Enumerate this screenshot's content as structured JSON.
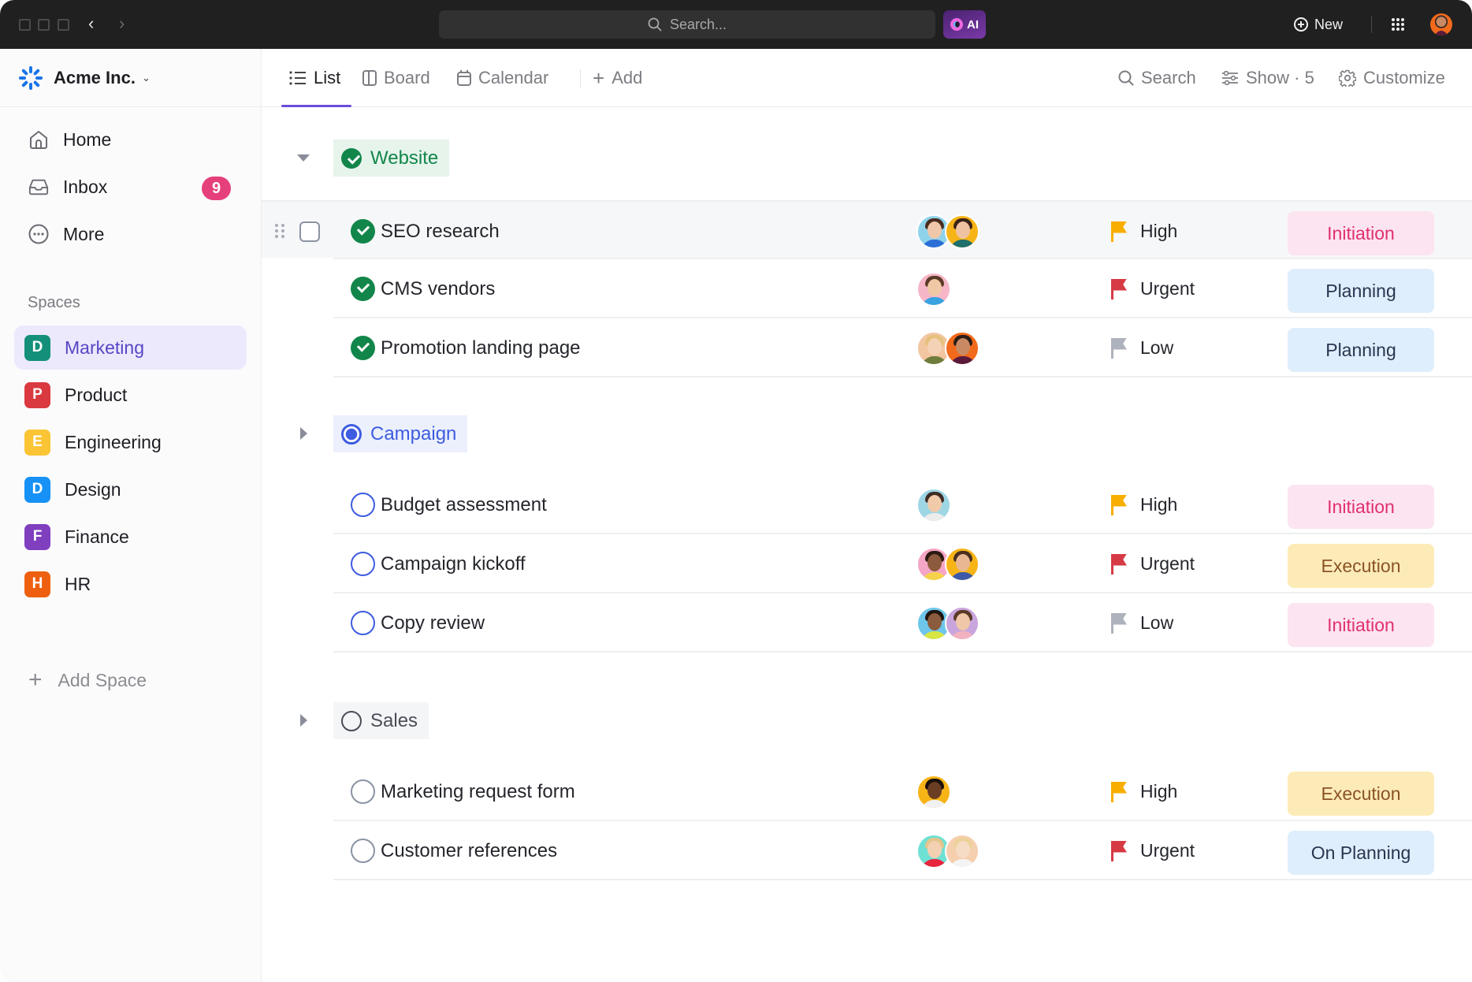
{
  "topbar": {
    "search_placeholder": "Search...",
    "ai_label": "AI",
    "new_label": "New"
  },
  "sidebar": {
    "workspace_name": "Acme Inc.",
    "nav": [
      {
        "label": "Home",
        "icon": "home-icon"
      },
      {
        "label": "Inbox",
        "icon": "inbox-icon",
        "badge": "9"
      },
      {
        "label": "More",
        "icon": "more-icon"
      }
    ],
    "spaces_label": "Spaces",
    "spaces": [
      {
        "initial": "D",
        "label": "Marketing",
        "color": "#14907a",
        "active": true
      },
      {
        "initial": "P",
        "label": "Product",
        "color": "#d9393f"
      },
      {
        "initial": "E",
        "label": "Engineering",
        "color": "#fbc435"
      },
      {
        "initial": "D",
        "label": "Design",
        "color": "#1791f5"
      },
      {
        "initial": "F",
        "label": "Finance",
        "color": "#7f3fbf"
      },
      {
        "initial": "H",
        "label": "HR",
        "color": "#ee6010"
      }
    ],
    "add_space_label": "Add Space"
  },
  "toolbar": {
    "tabs": [
      {
        "label": "List",
        "active": true
      },
      {
        "label": "Board"
      },
      {
        "label": "Calendar"
      }
    ],
    "add_label": "Add",
    "search_label": "Search",
    "show_label": "Show · 5",
    "customize_label": "Customize"
  },
  "colors": {
    "accent": "#6b4bdc",
    "done_green": "#12864a",
    "progress_blue": "#3d5ce0",
    "priority_high": "#f8ae00",
    "priority_urgent": "#d63a45",
    "priority_low": "#adb2bc"
  },
  "groups": [
    {
      "name": "Website",
      "status": "done",
      "expanded": true,
      "tasks": [
        {
          "name": "SEO research",
          "priority": "High",
          "stage": "Initiation",
          "assignees": 2
        },
        {
          "name": "CMS vendors",
          "priority": "Urgent",
          "stage": "Planning",
          "assignees": 1
        },
        {
          "name": "Promotion landing page",
          "priority": "Low",
          "stage": "Planning",
          "assignees": 2
        }
      ]
    },
    {
      "name": "Campaign",
      "status": "in-progress",
      "expanded": false,
      "tasks": [
        {
          "name": "Budget assessment",
          "priority": "High",
          "stage": "Initiation",
          "assignees": 1
        },
        {
          "name": "Campaign kickoff",
          "priority": "Urgent",
          "stage": "Execution",
          "assignees": 2
        },
        {
          "name": "Copy review",
          "priority": "Low",
          "stage": "Initiation",
          "assignees": 2
        }
      ]
    },
    {
      "name": "Sales",
      "status": "open",
      "expanded": false,
      "tasks": [
        {
          "name": "Marketing request form",
          "priority": "High",
          "stage": "Execution",
          "assignees": 1
        },
        {
          "name": "Customer references",
          "priority": "Urgent",
          "stage": "On Planning",
          "assignees": 2
        }
      ]
    }
  ]
}
